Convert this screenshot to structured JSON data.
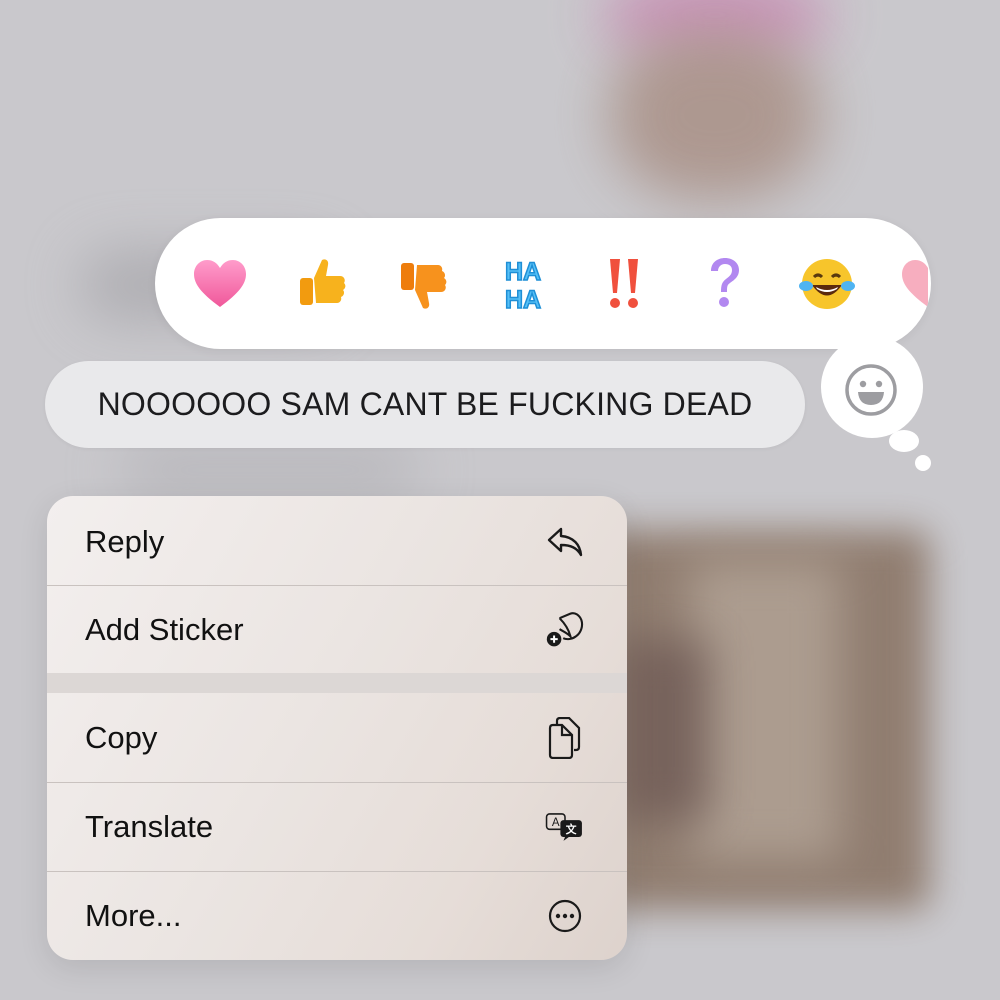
{
  "reactions": [
    {
      "name": "heart",
      "glyph": "heart-icon",
      "color": "#f56fa8"
    },
    {
      "name": "thumbs-up",
      "glyph": "thumbs-up-icon",
      "color": "#f7b21d"
    },
    {
      "name": "thumbs-down",
      "glyph": "thumbs-down-icon",
      "color": "#f7921d"
    },
    {
      "name": "haha",
      "glyph": "haha-icon",
      "color": "#3cb2f3",
      "top": "HA",
      "bottom": "HA"
    },
    {
      "name": "emphasize",
      "glyph": "double-exclamation-icon",
      "color": "#f0503d"
    },
    {
      "name": "question",
      "glyph": "question-icon",
      "color": "#b288f0"
    },
    {
      "name": "laughing-crying",
      "glyph": "tears-of-joy-icon",
      "color": "#f7c52b"
    }
  ],
  "message": {
    "text": "NOOOOOO SAM CANT BE FUCKING DEAD"
  },
  "menu": {
    "items": [
      {
        "label": "Reply",
        "icon": "reply-arrow-icon"
      },
      {
        "label": "Add Sticker",
        "icon": "add-sticker-icon"
      },
      {
        "label": "Copy",
        "icon": "copy-icon"
      },
      {
        "label": "Translate",
        "icon": "translate-icon"
      },
      {
        "label": "More...",
        "icon": "more-ellipsis-icon"
      }
    ]
  },
  "colors": {
    "bubble": "#e9e9eb",
    "reaction_bar": "#ffffff",
    "menu_text": "#111111"
  }
}
